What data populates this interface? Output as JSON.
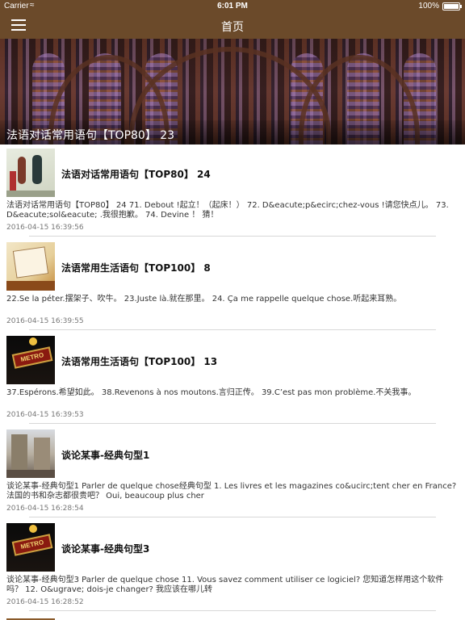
{
  "status_bar": {
    "carrier": "Carrier",
    "wifi_icon": "wifi-icon",
    "time": "6:01 PM",
    "battery": "100%"
  },
  "nav": {
    "menu_icon": "menu-icon",
    "title": "首页"
  },
  "hero": {
    "caption": "法语对话常用语句【TOP80】 23"
  },
  "items": [
    {
      "title": "法语对话常用语句【TOP80】 24",
      "desc": "法语对话常用语句【TOP80】 24 71. Debout !起立！（起床！） 72. D&eacute;p&ecirc;chez-vous !请您快点儿。 73. D&eacute;sol&eacute; .我很抱歉。 74. Devine ！ 猜！",
      "date": "2016-04-15 16:39:56"
    },
    {
      "title": "法语常用生活语句【TOP100】 8",
      "desc": "22.Se la péter.摆架子、吹牛。 23.Juste là.就在那里。 24. Ça me rappelle quelque chose.听起来耳熟。",
      "date": "2016-04-15 16:39:55"
    },
    {
      "title": "法语常用生活语句【TOP100】 13",
      "desc": "37.Espérons.希望如此。 38.Revenons à nos moutons.言归正传。 39.C’est pas mon problème.不关我事。",
      "date": "2016-04-15 16:39:53"
    },
    {
      "title": "谈论某事-经典句型1",
      "desc": "谈论某事-经典句型1 Parler de quelque chose经典句型 1. Les livres et les magazines co&ucirc;tent cher en France? 法国的书和杂志都很贵吧？ Oui, beaucoup plus cher",
      "date": "2016-04-15 16:28:54"
    },
    {
      "title": "谈论某事-经典句型3",
      "desc": "谈论某事-经典句型3 Parler de quelque chose 11. Vous savez comment utiliser ce logiciel? 您知道怎样用这个软件吗？ 12. O&ugrave; dois-je changer? 我应该在哪儿转",
      "date": "2016-04-15 16:28:52"
    }
  ],
  "thumb_icons": [
    "couple-eiffel-thumbnail",
    "chalkboard-sign-thumbnail",
    "metro-sign-thumbnail",
    "paris-street-thumbnail",
    "metro-sign-thumbnail"
  ]
}
